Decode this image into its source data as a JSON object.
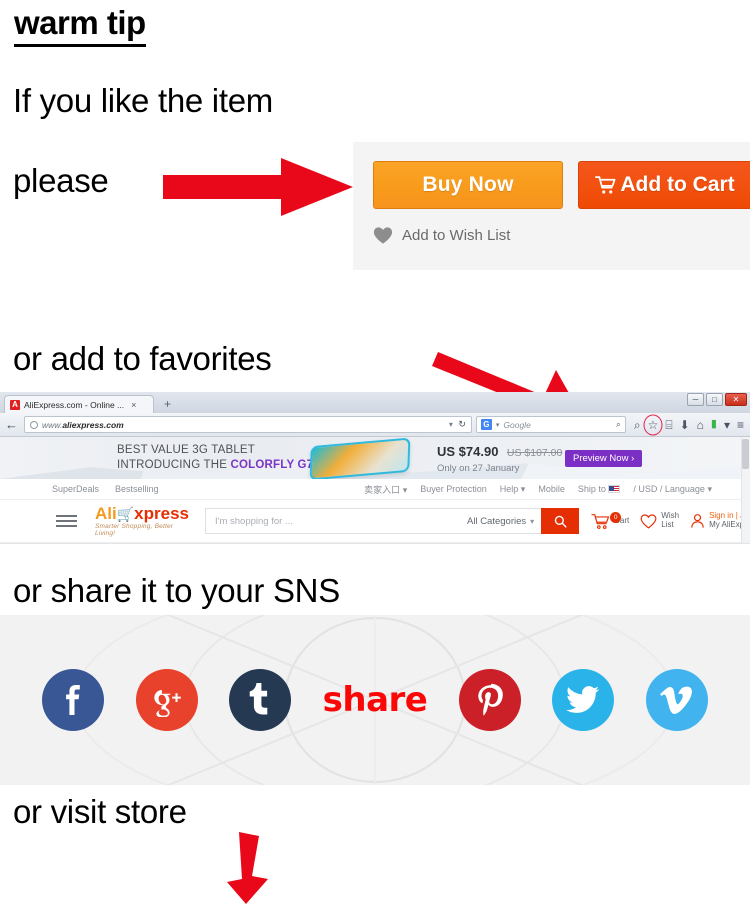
{
  "headings": {
    "warm_tip": "warm tip",
    "if_you_like": "If you like the item",
    "please": "please",
    "favorites": "or add to favorites",
    "sns": "or share it to your SNS",
    "visit_store": "or visit store"
  },
  "buy_panel": {
    "buy_now_label": "Buy Now",
    "add_to_cart_label": "Add to Cart",
    "wish_list_label": "Add to Wish List",
    "cart_icon": "cart-icon",
    "heart_icon": "heart-icon",
    "colors": {
      "buy_now": "#f7931d",
      "add_to_cart": "#f2500d",
      "panel_bg": "#f4f4f4"
    }
  },
  "browser": {
    "tab": {
      "favicon_letter": "A",
      "title": "AliExpress.com - Online ...",
      "close_glyph": "×",
      "new_tab_glyph": "+"
    },
    "window_controls": {
      "minimize": "─",
      "maximize": "□",
      "close": "✕"
    },
    "nav": {
      "back_glyph": "←",
      "url_prefix": "www.",
      "url_domain": "aliexpress.com",
      "url_caret": "▾",
      "reload_glyph": "↻"
    },
    "searchbox": {
      "provider_badge": "G",
      "provider_caret": "▾",
      "placeholder": "Google",
      "magnifier": "⌕"
    },
    "toolbar_icons": [
      {
        "name": "search-icon",
        "glyph": "⌕"
      },
      {
        "name": "star-icon",
        "glyph": "☆",
        "highlighted": true
      },
      {
        "name": "reading-list-icon",
        "glyph": "⌸"
      },
      {
        "name": "download-icon",
        "glyph": "⬇"
      },
      {
        "name": "home-icon",
        "glyph": "⌂"
      },
      {
        "name": "extension-icon",
        "glyph": "▮"
      },
      {
        "name": "extension-caret-icon",
        "glyph": "▾"
      },
      {
        "name": "menu-icon",
        "glyph": "≡"
      }
    ],
    "promo": {
      "line1": "BEST VALUE 3G TABLET",
      "line2_prefix": "INTRODUCING THE ",
      "line2_brand": "COLORFLY G708",
      "price": "US $74.90",
      "price_old": "US $107.00",
      "subtitle": "Only on 27 January",
      "cta": "Preview Now ›",
      "cta_color": "#7b2fc4",
      "brand_color": "#7b35c6"
    },
    "topnav_left": [
      "SuperDeals",
      "Bestselling"
    ],
    "topnav_right": [
      {
        "label": "卖家入口",
        "caret": "▾"
      },
      {
        "label": "Buyer Protection",
        "caret": ""
      },
      {
        "label": "Help",
        "caret": "▾"
      },
      {
        "label": "Mobile",
        "caret": ""
      },
      {
        "label": "Ship to",
        "caret": ""
      },
      {
        "label": "/ USD / Language",
        "caret": "▾"
      }
    ],
    "header": {
      "logo_ali": "Ali",
      "logo_cart": "Ὥ2",
      "logo_xpress": "xpress",
      "tagline": "Smarter Shopping, Better Living!",
      "search_placeholder": "I'm shopping for ...",
      "category_label": "All Categories",
      "category_caret": "▾",
      "search_button_icon": "search-icon",
      "cart_count": "0",
      "cart_label": "Cart",
      "wish_line1": "Wish",
      "wish_line2": "List",
      "account_line1": "Sign in | Join",
      "account_line2": "My AliExpress",
      "accent_color": "#e62e04"
    }
  },
  "sns": {
    "share_word": "share",
    "share_color": "#fb0707",
    "icons": [
      {
        "name": "facebook-icon",
        "glyph": "f",
        "color": "#3a5795"
      },
      {
        "name": "google-plus-icon",
        "glyph": "g+",
        "color": "#e8412c"
      },
      {
        "name": "tumblr-icon",
        "glyph": "t",
        "color": "#253a52"
      },
      {
        "name": "pinterest-icon",
        "glyph": "p",
        "color": "#cb2027"
      },
      {
        "name": "twitter-icon",
        "glyph": "bird",
        "color": "#2ab3e8"
      },
      {
        "name": "vimeo-icon",
        "glyph": "v",
        "color": "#41b3ef"
      }
    ]
  },
  "arrows": {
    "right_arrow": "arrow-right-icon",
    "diagonal_arrow": "arrow-diagonal-icon",
    "down_arrow": "arrow-down-icon",
    "color": "#e8081a"
  }
}
